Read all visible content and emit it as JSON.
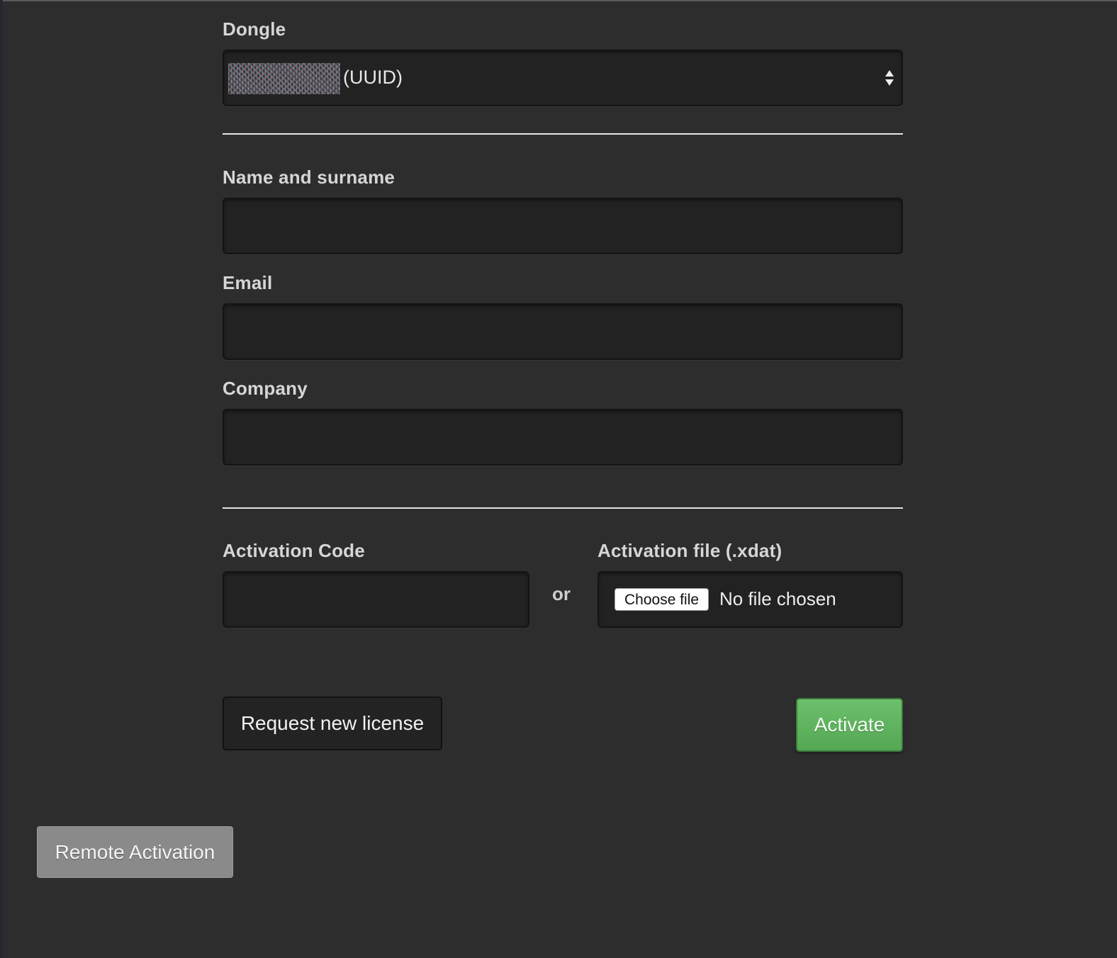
{
  "dongle": {
    "label": "Dongle",
    "selected_suffix": "(UUID)"
  },
  "form": {
    "name_label": "Name and surname",
    "name_value": "",
    "email_label": "Email",
    "email_value": "",
    "company_label": "Company",
    "company_value": ""
  },
  "activation": {
    "code_label": "Activation Code",
    "code_value": "",
    "or_text": "or",
    "file_label": "Activation file (.xdat)",
    "choose_file_label": "Choose file",
    "file_status": "No file chosen"
  },
  "actions": {
    "request_label": "Request new license",
    "activate_label": "Activate",
    "remote_label": "Remote Activation"
  },
  "colors": {
    "background": "#2d2d2d",
    "activate_green": "#5cb85c",
    "remote_gray": "#8a8a8a"
  }
}
